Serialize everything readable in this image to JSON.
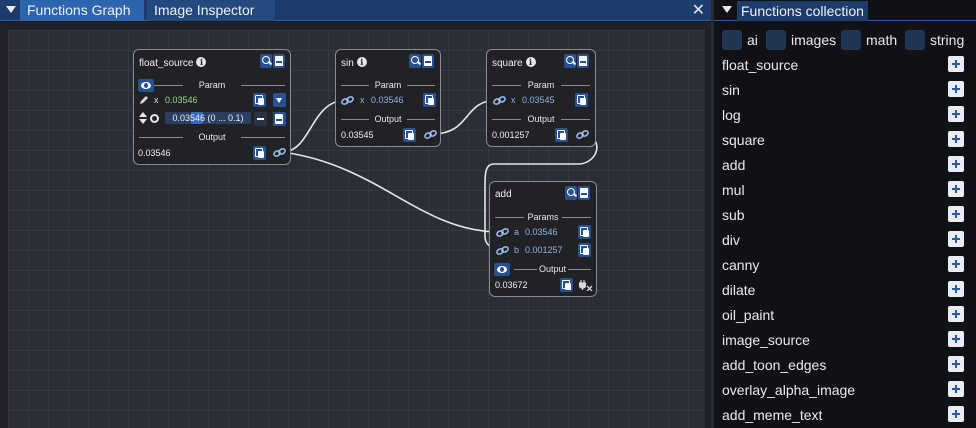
{
  "graph_panel": {
    "tabs": [
      {
        "label": "Functions Graph",
        "active": true
      },
      {
        "label": "Image Inspector",
        "active": false
      }
    ],
    "close_symbol": "✕"
  },
  "nodes": {
    "float_source": {
      "title": "float_source",
      "param_section": "Param",
      "param_name": "x",
      "param_value": "0.03546",
      "slider_text": "0.03546  (0 ... 0.1)",
      "slider_fraction": 0.3546,
      "output_section": "Output",
      "output_value": "0.03546"
    },
    "sin": {
      "title": "sin",
      "param_section": "Param",
      "param_name": "x",
      "param_value": "0.03546",
      "output_section": "Output",
      "output_value": "0.03545"
    },
    "square": {
      "title": "square",
      "param_section": "Param",
      "param_name": "x",
      "param_value": "0.03545",
      "output_section": "Output",
      "output_value": "0.001257"
    },
    "add": {
      "title": "add",
      "params_section": "Params",
      "param_a_name": "a",
      "param_a_value": "0.03546",
      "param_b_name": "b",
      "param_b_value": "0.001257",
      "output_section": "Output",
      "output_value": "0.03672"
    }
  },
  "functions_panel": {
    "title": "Functions collection",
    "filters": [
      {
        "label": "ai",
        "checked": false
      },
      {
        "label": "images",
        "checked": false
      },
      {
        "label": "math",
        "checked": false
      },
      {
        "label": "string",
        "checked": false
      }
    ],
    "functions": [
      "float_source",
      "sin",
      "log",
      "square",
      "add",
      "mul",
      "sub",
      "div",
      "canny",
      "dilate",
      "oil_paint",
      "image_source",
      "add_toon_edges",
      "overlay_alpha_image",
      "add_meme_text"
    ]
  },
  "colors": {
    "accent": "#2d64b0",
    "button": "#275190",
    "green_value": "#9bd889",
    "blue_value": "#8fb2e8",
    "link_wire": "#e6e6e6"
  }
}
